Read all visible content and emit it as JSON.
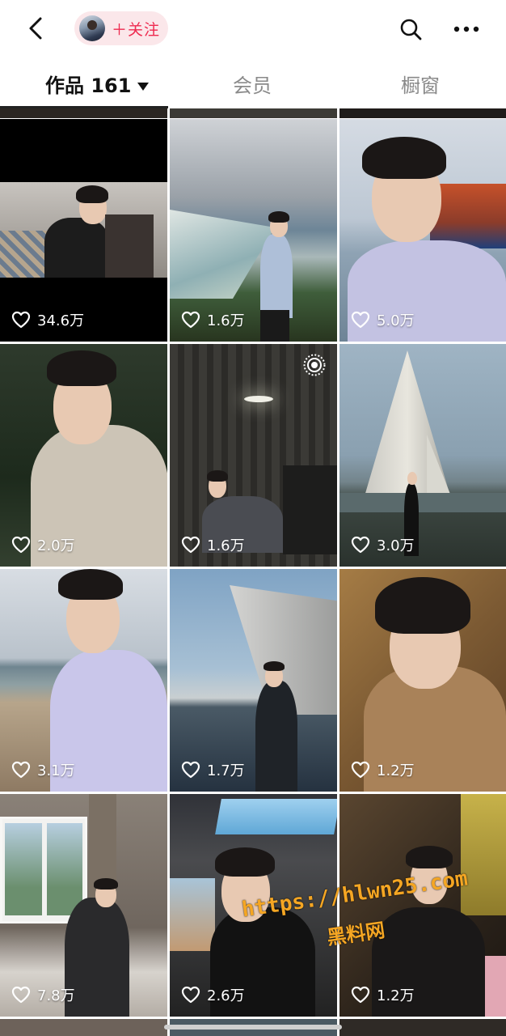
{
  "header": {
    "follow_label": "＋关注"
  },
  "tabs": [
    {
      "label": "作品 161"
    },
    {
      "label": "会员"
    },
    {
      "label": "橱窗"
    }
  ],
  "icons": {
    "back": "chevron-left-icon",
    "search": "search-icon",
    "more": "more-dots-icon",
    "like": "heart-outline-icon",
    "live": "live-broadcast-icon"
  },
  "colors": {
    "accent": "#ee2a4f",
    "follow_bg": "#fbe7ea",
    "watermark": "#f5a623"
  },
  "videos": [
    {
      "likes": "34.6万"
    },
    {
      "likes": "1.6万"
    },
    {
      "likes": "5.0万"
    },
    {
      "likes": "2.0万"
    },
    {
      "likes": "1.6万"
    },
    {
      "likes": "3.0万"
    },
    {
      "likes": "3.1万"
    },
    {
      "likes": "1.7万"
    },
    {
      "likes": "1.2万"
    },
    {
      "likes": "7.8万"
    },
    {
      "likes": "2.6万"
    },
    {
      "likes": "1.2万"
    }
  ],
  "watermark": {
    "url": "https://hlwn25.com",
    "name": "黑料网"
  }
}
